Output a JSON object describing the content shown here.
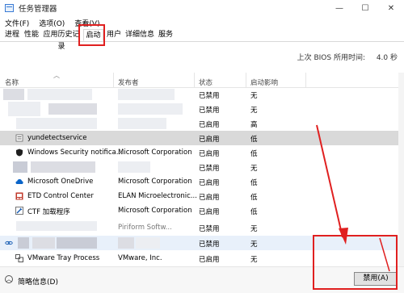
{
  "window": {
    "title": "任务管理器",
    "minimize": "—",
    "maximize": "☐",
    "close": "✕"
  },
  "menu": [
    "文件(F)",
    "选项(O)",
    "查看(V)"
  ],
  "tabs": [
    "进程",
    "性能",
    "应用历史记录",
    "启动",
    "用户",
    "详细信息",
    "服务"
  ],
  "active_tab": "启动",
  "bios": {
    "label": "上次 BIOS 所用时间:",
    "value": "4.0 秒"
  },
  "columns": {
    "name": "名称",
    "publisher": "发布者",
    "status": "状态",
    "impact": "启动影响"
  },
  "rows": [
    {
      "name": "",
      "publisher": "",
      "status": "已禁用",
      "impact": "无"
    },
    {
      "name": "",
      "publisher": "",
      "status": "已禁用",
      "impact": "无"
    },
    {
      "name": "",
      "publisher": "",
      "status": "已启用",
      "impact": "高"
    },
    {
      "name": "yundetectservice",
      "publisher": "",
      "status": "已启用",
      "impact": "低",
      "icon": "app-icon"
    },
    {
      "name": "Windows Security notifica...",
      "publisher": "Microsoft Corporation",
      "status": "已启用",
      "impact": "低",
      "icon": "shield-icon"
    },
    {
      "name": "",
      "publisher": "",
      "status": "已禁用",
      "impact": "无"
    },
    {
      "name": "Microsoft OneDrive",
      "publisher": "Microsoft Corporation",
      "status": "已启用",
      "impact": "低",
      "icon": "cloud-icon"
    },
    {
      "name": "ETD Control Center",
      "publisher": "ELAN Microelectronic...",
      "status": "已启用",
      "impact": "低",
      "icon": "touchpad-icon"
    },
    {
      "name": "CTF 加载程序",
      "publisher": "Microsoft Corporation",
      "status": "已启用",
      "impact": "低",
      "icon": "ctf-icon"
    },
    {
      "name": "",
      "publisher": "Piriform Softw...",
      "status": "已禁用",
      "impact": "无"
    },
    {
      "name": "",
      "publisher": "",
      "status": "已禁用",
      "impact": "无",
      "icon": "link-icon"
    },
    {
      "name": "VMware Tray Process",
      "publisher": "VMware, Inc.",
      "status": "已启用",
      "impact": "无",
      "icon": "vmware-icon"
    }
  ],
  "statusbar": {
    "less_details": "简略信息(D)",
    "disable_button": "禁用(A)"
  }
}
